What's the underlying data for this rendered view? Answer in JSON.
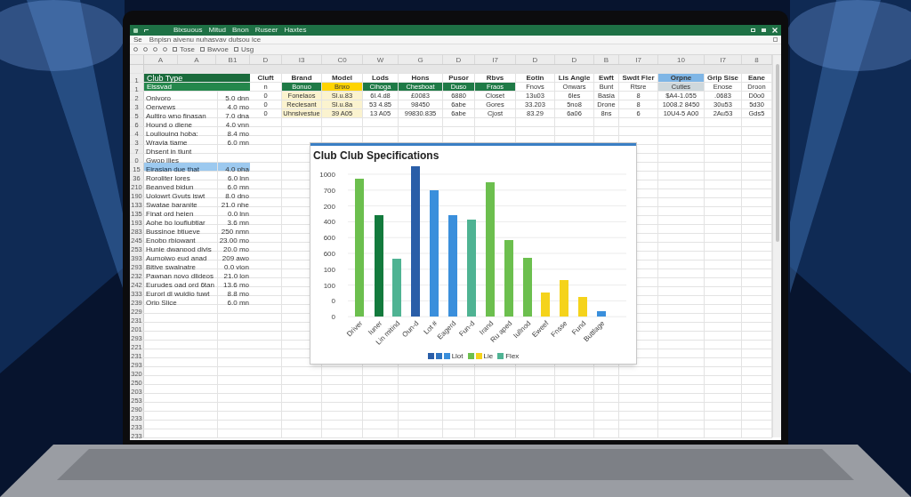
{
  "title_bar": {
    "tabs": [
      "Bixsuous",
      "Mitud",
      "Bnon",
      "Ruseer",
      "Haxtes"
    ]
  },
  "formula_bar": {
    "cell": "Se",
    "text": "Bnpisn aivenu nuhasvav dutsou ice"
  },
  "toolbar": {
    "labels": [
      "Tose",
      "Bwvoe",
      "Usg"
    ]
  },
  "columns": [
    "A",
    "A",
    "B1",
    "D",
    "I3",
    "C0",
    "W",
    "G",
    "D",
    "I7",
    "D",
    "D",
    "B",
    "I7",
    "10",
    "I7",
    "8"
  ],
  "left_rows": [
    {
      "kind": "blank"
    },
    {
      "kind": "header",
      "number": "1",
      "label": "Club Type"
    },
    {
      "kind": "band",
      "number": "1",
      "label": "Elssvad"
    },
    {
      "kind": "data",
      "number": "2",
      "label": "Oniyoro",
      "value": "5.0 dnn",
      "selected": false
    },
    {
      "kind": "data",
      "number": "3",
      "label": "Oenvews",
      "value": "4.0 mo",
      "selected": false
    },
    {
      "kind": "data",
      "number": "5",
      "label": "Aultiro wno finasan",
      "value": "7.0 dna",
      "selected": false
    },
    {
      "kind": "data",
      "number": "6",
      "label": "Hound o diene",
      "value": "4.0 vnn",
      "selected": false
    },
    {
      "kind": "data",
      "number": "4",
      "label": "Louliouing hoba:",
      "value": "8.4 mo",
      "selected": false
    },
    {
      "kind": "data",
      "number": "3",
      "label": "Wravia tiame",
      "value": "6.0 mn",
      "selected": false
    },
    {
      "kind": "data",
      "number": "7",
      "label": "Dhsent in tlunt",
      "selected": false
    },
    {
      "kind": "data",
      "number": "0",
      "label": "Gwop ilies",
      "selected": false
    },
    {
      "kind": "data",
      "number": "15",
      "label": "Eirasian due that",
      "value": "4.0 pha",
      "selected": true
    },
    {
      "kind": "data",
      "number": "36",
      "label": "Roroliter lores",
      "value": "6.0 lnn",
      "selected": false
    },
    {
      "kind": "data",
      "number": "210",
      "label": "Beanved bidun",
      "value": "6.0 mn",
      "selected": false
    },
    {
      "kind": "data",
      "number": "190",
      "label": "Uolowrt Gvuts iswt",
      "value": "8.0 dno",
      "selected": false
    },
    {
      "kind": "data",
      "number": "133",
      "label": "Swatae baranite",
      "value": "21.0 nhe",
      "selected": false
    },
    {
      "kind": "data",
      "number": "135",
      "label": "Finat ord heien",
      "value": "0.0 lnn",
      "selected": false
    },
    {
      "kind": "data",
      "number": "193",
      "label": "Aohe bo louflubtiar",
      "value": "3.6 mn",
      "selected": false
    },
    {
      "kind": "data",
      "number": "283",
      "label": "Bussinoe btiueve",
      "value": "250 nmn",
      "selected": false
    },
    {
      "kind": "data",
      "number": "245",
      "label": "Enobp rbjowant",
      "value": "23.00 mo",
      "selected": false
    },
    {
      "kind": "data",
      "number": "253",
      "label": "Hunie dwanpod divis",
      "value": "20.0 mo",
      "selected": false
    },
    {
      "kind": "data",
      "number": "393",
      "label": "Aumoiwo eud anad",
      "value": "209 awo",
      "selected": false
    },
    {
      "kind": "data",
      "number": "293",
      "label": "Bitive swalnatre",
      "value": "0.0 vion",
      "selected": false
    },
    {
      "kind": "data",
      "number": "232",
      "label": "Pawnan novo dlideos",
      "value": "21.0 lon",
      "selected": false
    },
    {
      "kind": "data",
      "number": "242",
      "label": "Eurudes oad ord 6tan",
      "value": "13.6 mo",
      "selected": false
    },
    {
      "kind": "data",
      "number": "333",
      "label": "Eurorl dl wuidio tuwt",
      "value": "8.8 mo",
      "selected": false
    },
    {
      "kind": "data",
      "number": "239",
      "label": "Orip Slice",
      "value": "6.0 mn",
      "selected": false
    },
    {
      "kind": "data",
      "number": "229",
      "selected": false
    },
    {
      "kind": "data",
      "number": "231",
      "selected": false
    },
    {
      "kind": "data",
      "number": "201",
      "selected": false
    },
    {
      "kind": "data",
      "number": "293",
      "selected": false
    },
    {
      "kind": "data",
      "number": "221",
      "selected": false
    },
    {
      "kind": "data",
      "number": "231",
      "selected": false
    },
    {
      "kind": "data",
      "number": "293",
      "selected": false
    },
    {
      "kind": "data",
      "number": "320",
      "selected": false
    },
    {
      "kind": "data",
      "number": "250",
      "selected": false
    },
    {
      "kind": "data",
      "number": "203",
      "selected": false
    },
    {
      "kind": "data",
      "number": "253",
      "selected": false
    },
    {
      "kind": "data",
      "number": "290",
      "selected": false
    },
    {
      "kind": "data",
      "number": "233",
      "selected": false
    },
    {
      "kind": "data",
      "number": "233",
      "selected": false
    },
    {
      "kind": "data",
      "number": "233",
      "selected": false
    }
  ],
  "table": [
    {
      "kind": "header",
      "cells": [
        {
          "text": "Cluft"
        },
        {
          "text": "Brand"
        },
        {
          "text": "Model"
        },
        {
          "text": "Lods"
        },
        {
          "text": "Hons"
        },
        {
          "text": "Pusor"
        },
        {
          "text": "Rbvs"
        },
        {
          "text": "Eotin"
        },
        {
          "text": "Lis Angle"
        },
        {
          "text": "Ewft"
        },
        {
          "text": "Swdt Fler"
        },
        {
          "text": "Orpne",
          "color": "#7fb6e6"
        },
        {
          "text": "Grip Sise"
        },
        {
          "text": "Eane"
        }
      ]
    },
    {
      "kind": "data",
      "cells": [
        {
          "text": "n"
        },
        {
          "text": "Bonuo",
          "color": "#1e7a46"
        },
        {
          "text": "Bnxo",
          "color": "#ffd400"
        },
        {
          "text": "Cihoga",
          "color": "#1e7a46"
        },
        {
          "text": "Chesboat",
          "color": "#1e7a46"
        },
        {
          "text": "Duso",
          "color": "#1e7a46"
        },
        {
          "text": "Fraos",
          "color": "#1e7a46"
        },
        {
          "text": "Fnovs"
        },
        {
          "text": "Onwars"
        },
        {
          "text": "Bunt"
        },
        {
          "text": "Rtsre"
        },
        {
          "text": "Cuties",
          "color": "#cfd8dc"
        },
        {
          "text": "Enose"
        },
        {
          "text": "Droon"
        }
      ]
    },
    {
      "kind": "data",
      "cells": [
        {
          "text": "0"
        },
        {
          "text": "Fonelaos",
          "color": "#fbf3cf"
        },
        {
          "text": "Sl.u.83",
          "color": "#fbf3cf"
        },
        {
          "text": "6l.4.d8"
        },
        {
          "text": "£0083"
        },
        {
          "text": "6880"
        },
        {
          "text": "Closet"
        },
        {
          "text": "13u03"
        },
        {
          "text": "6les"
        },
        {
          "text": "Basia"
        },
        {
          "text": "8"
        },
        {
          "text": "$A4-1.055"
        },
        {
          "text": ".0683"
        },
        {
          "text": "D0o0"
        }
      ]
    },
    {
      "kind": "data",
      "cells": [
        {
          "text": "0"
        },
        {
          "text": "Reclesant",
          "color": "#fbf3cf"
        },
        {
          "text": "Sl.u.8a",
          "color": "#fbf3cf"
        },
        {
          "text": "53 4.85"
        },
        {
          "text": "98450"
        },
        {
          "text": "6abe"
        },
        {
          "text": "Gores"
        },
        {
          "text": "33.203"
        },
        {
          "text": "5no8"
        },
        {
          "text": "Drone"
        },
        {
          "text": "8"
        },
        {
          "text": "1008.2 8450"
        },
        {
          "text": "30u53"
        },
        {
          "text": "5d30"
        }
      ]
    },
    {
      "kind": "data",
      "cells": [
        {
          "text": "0"
        },
        {
          "text": "Uhnslvestue",
          "color": "#fbf3cf"
        },
        {
          "text": "39 A05",
          "color": "#fbf3cf"
        },
        {
          "text": "13 A05"
        },
        {
          "text": "99830.835"
        },
        {
          "text": "6abe"
        },
        {
          "text": "Cjost"
        },
        {
          "text": "83.29"
        },
        {
          "text": "6a06"
        },
        {
          "text": "8ns"
        },
        {
          "text": "6"
        },
        {
          "text": "10U4-5 A00"
        },
        {
          "text": "2Au53"
        },
        {
          "text": "Gds5"
        }
      ]
    }
  ],
  "chart": {
    "title": "Club Club Specifications",
    "tick_labels": [
      "1000",
      "700",
      "200",
      "400",
      "600",
      "600",
      "100",
      "100",
      "0",
      "0"
    ],
    "categories": [
      "Driver",
      "Iuner",
      "Lin mitind",
      "Oun-d",
      "Lot #",
      "Eagerd",
      "Fun-d",
      "Irand",
      "Ru aped",
      "Iullnod",
      "Eweef",
      "Fnsse",
      "Fund",
      "Buttlage"
    ],
    "legend": [
      {
        "label": "Llot",
        "swatches": [
          {
            "color": "#2a5ea8"
          },
          {
            "color": "#2f74c0"
          },
          {
            "color": "#3a8fdc"
          }
        ]
      },
      {
        "label": "Lie",
        "swatches": [
          {
            "color": "#6cbf4e"
          },
          {
            "color": "#f5d31b"
          }
        ]
      },
      {
        "label": "Flex",
        "swatches": [
          {
            "color": "#4fb393"
          }
        ]
      }
    ]
  }
}
